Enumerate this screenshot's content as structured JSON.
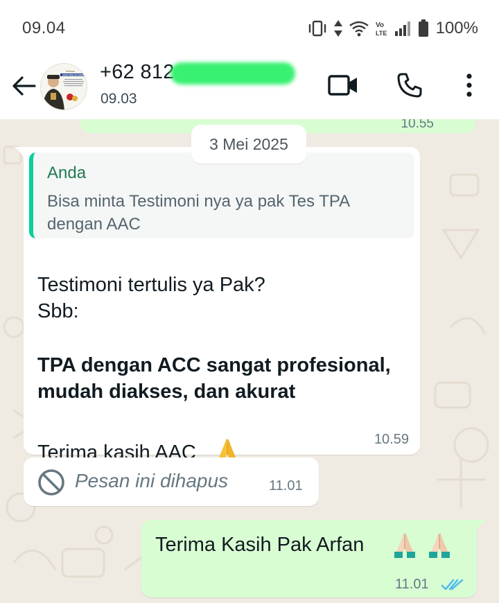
{
  "status_bar": {
    "time": "09.04",
    "network_label": "Vo LTE",
    "battery": "100%"
  },
  "header": {
    "contact_name": "+62 812",
    "last_seen": "09.03",
    "avatar_label": "HARI PENGAYOMAN"
  },
  "chat": {
    "date_chip": "3 Mei 2025",
    "previous_time": "10.55",
    "messages": [
      {
        "direction": "incoming",
        "quote_author": "Anda",
        "quote_text": "Bisa minta Testimoni nya ya pak Tes TPA dengan AAC",
        "lines": [
          "Testimoni tertulis ya Pak?",
          "Sbb:"
        ],
        "bold_lines": [
          "TPA dengan ACC sangat profesional,",
          "mudah diakses, dan akurat"
        ],
        "closing": "Terima kasih AAC",
        "time": "10.59"
      },
      {
        "direction": "incoming",
        "deleted_text": "Pesan ini dihapus",
        "time": "11.01"
      },
      {
        "direction": "outgoing",
        "text": "Terima Kasih Pak Arfan",
        "time": "11.01",
        "status": "read"
      }
    ]
  },
  "colors": {
    "chat_bg": "#efeae2",
    "incoming_bubble": "#ffffff",
    "outgoing_bubble": "#d9fdd3",
    "quote_bar": "#06cf9c",
    "quote_author": "#1f7a52",
    "read_ticks": "#53bdeb"
  },
  "icons": [
    "back-arrow-icon",
    "video-call-icon",
    "phone-icon",
    "more-vert-icon",
    "blocked-icon",
    "folded-hands-emoji",
    "double-check-icon"
  ]
}
